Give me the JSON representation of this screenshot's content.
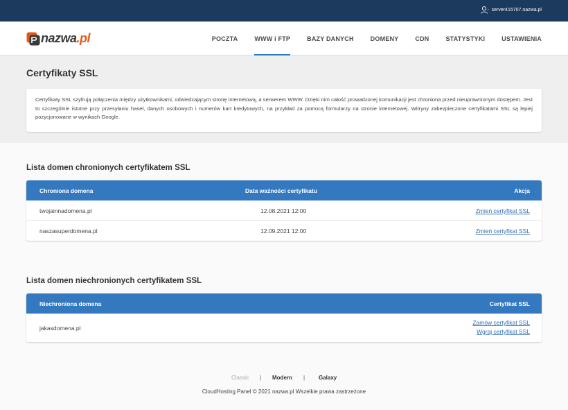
{
  "topbar": {
    "server": "server415707.nazwa.pl"
  },
  "logo": {
    "name": "nazwa",
    "tld": ".pl"
  },
  "nav": [
    {
      "label": "POCZTA"
    },
    {
      "label": "WWW i FTP"
    },
    {
      "label": "BAZY DANYCH"
    },
    {
      "label": "DOMENY"
    },
    {
      "label": "CDN"
    },
    {
      "label": "STATYSTYKI"
    },
    {
      "label": "USTAWIENIA"
    }
  ],
  "page": {
    "title": "Certyfikaty SSL",
    "description": "Certyfikaty SSL szyfrują połączenia między użytkownikami, odwiedzającym stronę internetową, a serwerem WWW. Dzięki nim całość prowadzonej komunikacji jest chroniona przed nieuprawnionym dostępem. Jest to szczególnie istotne przy przesyłaniu haseł, danych osobowych i numerów kart kredytowych, na przykład za pomocą formularzy na stronie internetowej. Witryny zabezpieczone certyfikatami SSL są lepiej pozycjonowane w wynikach Google."
  },
  "protected": {
    "title": "Lista domen chronionych certyfikatem SSL",
    "headers": {
      "domain": "Chroniona domena",
      "expiry": "Data ważności certyfikatu",
      "action": "Akcja"
    },
    "rows": [
      {
        "domain": "twojainnadomena.pl",
        "expiry": "12.08.2021 12:00",
        "action": "Zmień certyfikat SSL"
      },
      {
        "domain": "naszasuperdomena.pl",
        "expiry": "12.09.2021 12:00",
        "action": "Zmień certyfikat SSL"
      }
    ]
  },
  "unprotected": {
    "title": "Lista domen niechronionych certyfikatem SSL",
    "headers": {
      "domain": "Niechroniona domena",
      "cert": "Certyfikat SSL"
    },
    "rows": [
      {
        "domain": "jakasdomena.pl",
        "order": "Zamów certyfikat SSL",
        "upload": "Wgraj certyfikat SSL"
      }
    ]
  },
  "footer": {
    "themes": [
      "Classic",
      "Modern",
      "Galaxy"
    ],
    "separator": "|",
    "copyright": "CloudHosting Panel © 2021 nazwa.pl Wszelkie prawa zastrzeżone"
  },
  "colors": {
    "topbar": "#1c3a5e",
    "accent": "#3479c0",
    "link": "#2e6fb0",
    "brand_orange": "#e05a1a"
  }
}
